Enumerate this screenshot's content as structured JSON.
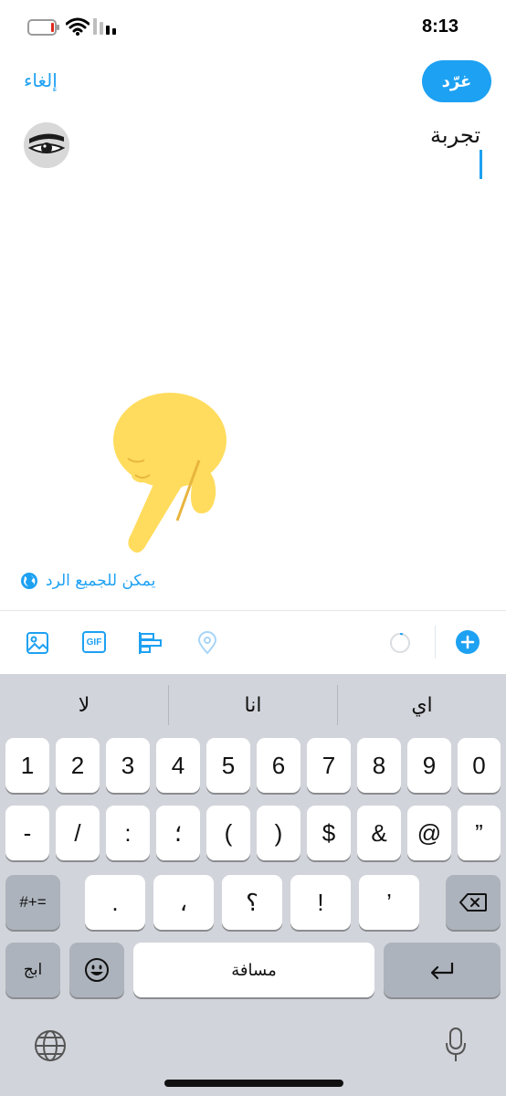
{
  "status_bar": {
    "time": "8:13"
  },
  "header": {
    "cancel_label": "إلغاء",
    "tweet_label": "غرّد"
  },
  "compose": {
    "text": "تجربة"
  },
  "reply_setting": {
    "label": "يمكن للجميع الرد",
    "icon": "globe-icon"
  },
  "toolbar": {
    "icons": [
      "image-icon",
      "gif-icon",
      "poll-icon",
      "location-icon",
      "character-progress-ring",
      "add-tweet-icon"
    ],
    "gif_label": "GIF"
  },
  "keyboard": {
    "suggestions": [
      "لا",
      "انا",
      "اي"
    ],
    "row1": [
      "1",
      "2",
      "3",
      "4",
      "5",
      "6",
      "7",
      "8",
      "9",
      "0"
    ],
    "row2": [
      "-",
      "/",
      ":",
      "؛",
      "(",
      ")",
      "$",
      "&",
      "@",
      "”"
    ],
    "row3": [
      ".",
      "،",
      "؟",
      "!",
      "’"
    ],
    "symbols_key": "#+=",
    "abc_key": "ابج",
    "space_label": "مسافة",
    "icons": [
      "backspace-icon",
      "emoji-icon",
      "return-icon",
      "globe-keyboard-icon",
      "microphone-icon"
    ]
  },
  "colors": {
    "accent": "#1da1f2",
    "keyboard_bg": "#d1d4da",
    "hand_emoji": "#ffdc5d"
  }
}
